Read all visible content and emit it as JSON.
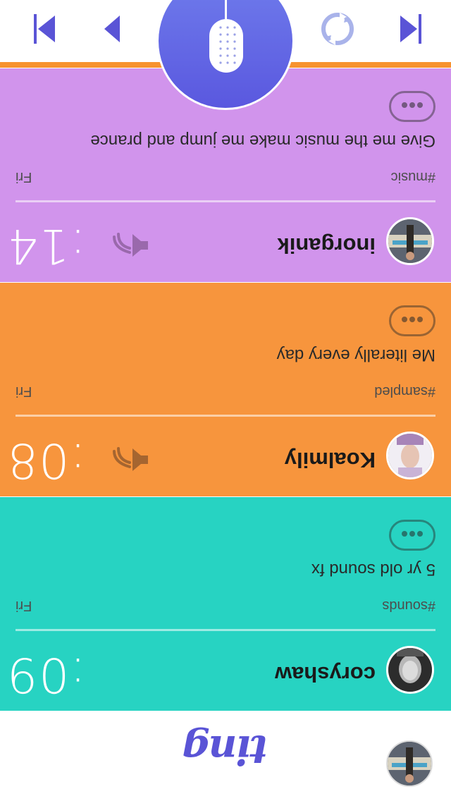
{
  "app": {
    "logo_text": "ting"
  },
  "colors": {
    "accent": "#5a54d6",
    "card_teal": "#27d3c2",
    "card_orange": "#f7953d",
    "card_purple": "#d194ec",
    "player_orange_line": "#f7932f"
  },
  "feed": [
    {
      "username": "coryshaw",
      "duration": ":09",
      "tag": "#sounds",
      "day": "Fri",
      "caption": "5 yr old sound fx",
      "color": "#27d3c2",
      "show_speaker": false
    },
    {
      "username": "Koalmily",
      "duration": ":08",
      "tag": "#sampled",
      "day": "Fri",
      "caption": "Me literally every day",
      "color": "#f7953d",
      "show_speaker": true
    },
    {
      "username": "inorganik",
      "duration": ":14",
      "tag": "#music",
      "day": "Fri",
      "caption": "Give me the music make me jump and prance",
      "color": "#d194ec",
      "show_speaker": true
    }
  ],
  "player": {
    "icons": [
      "skip-to-start-icon",
      "previous-icon",
      "microphone-icon",
      "refresh-icon",
      "skip-to-end-icon"
    ]
  }
}
